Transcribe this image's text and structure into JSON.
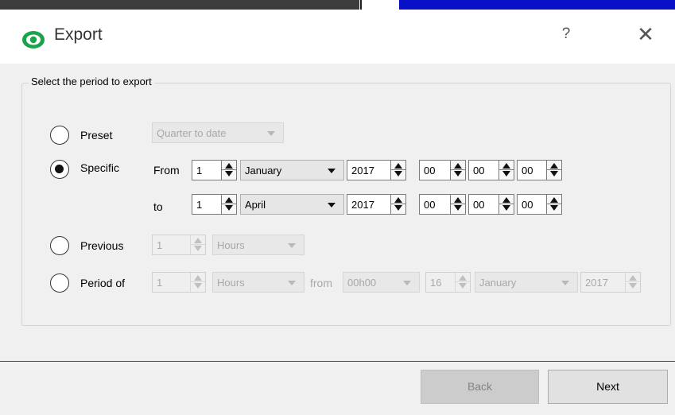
{
  "dialog": {
    "title": "Export",
    "help_label": "?",
    "close_label": "✕"
  },
  "group": {
    "title": "Select the period to export"
  },
  "options": {
    "preset": {
      "label": "Preset",
      "selected": false,
      "value": "Quarter to date"
    },
    "specific": {
      "label": "Specific",
      "selected": true,
      "from": {
        "label": "From",
        "day": "1",
        "month": "January",
        "year": "2017",
        "hour": "00",
        "minute": "00",
        "second": "00"
      },
      "to": {
        "label": "to",
        "day": "1",
        "month": "April",
        "year": "2017",
        "hour": "00",
        "minute": "00",
        "second": "00"
      }
    },
    "previous": {
      "label": "Previous",
      "selected": false,
      "count": "1",
      "unit": "Hours"
    },
    "period_of": {
      "label": "Period of",
      "selected": false,
      "count": "1",
      "unit": "Hours",
      "from_label": "from",
      "time": "00h00",
      "day": "16",
      "month": "January",
      "year": "2017"
    }
  },
  "footer": {
    "back_label": "Back",
    "next_label": "Next"
  },
  "icons": {
    "app": "eye-icon",
    "help": "question-icon",
    "close": "close-icon"
  },
  "colors": {
    "accent_green": "#1aa34a",
    "disabled_text": "#a8a8a8"
  }
}
